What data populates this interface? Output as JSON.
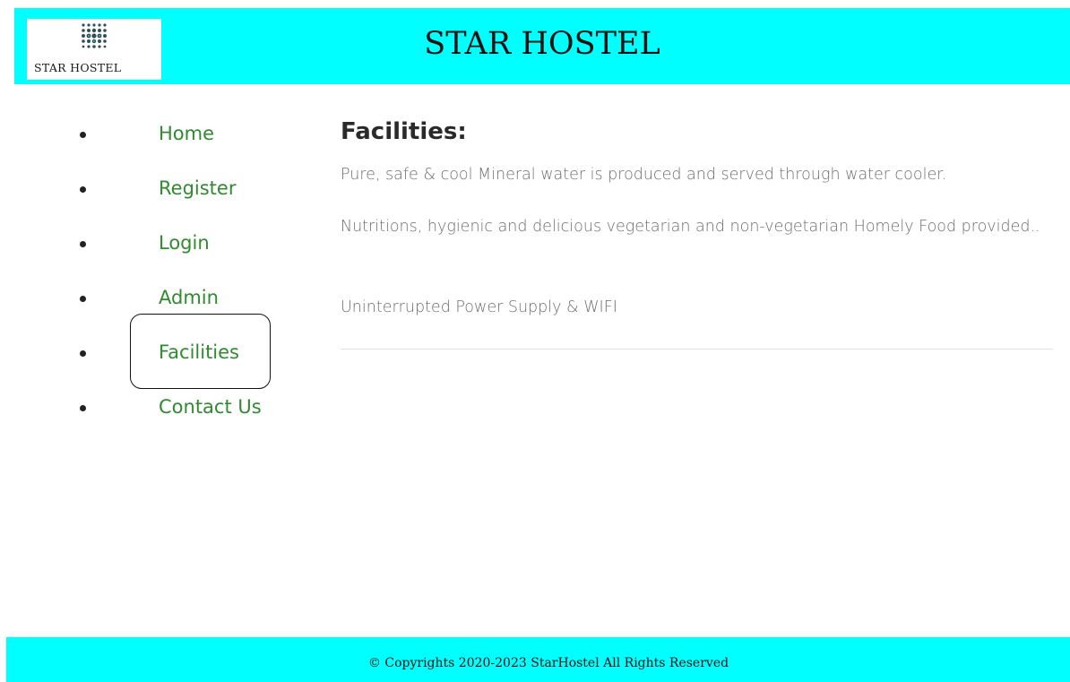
{
  "header": {
    "logo_text": "STAR HOSTEL",
    "title": "STAR HOSTEL",
    "background_color": "#00ffff"
  },
  "nav": {
    "items": [
      {
        "label": "Home"
      },
      {
        "label": "Register"
      },
      {
        "label": "Login"
      },
      {
        "label": "Admin"
      },
      {
        "label": "Facilities"
      },
      {
        "label": "Contact Us"
      }
    ],
    "link_color": "#2e8b2e",
    "highlighted_item": "Facilities"
  },
  "main": {
    "heading": "Facilities:",
    "paragraphs": [
      "Pure, safe & cool Mineral water is produced and served through water cooler.",
      "Nutritions, hygienic and delicious vegetarian and non-vegetarian Homely Food provided..",
      "Uninterrupted Power Supply & WIFI"
    ]
  },
  "footer": {
    "text": "© Copyrights 2020-2023 StarHostel All Rights Reserved"
  }
}
